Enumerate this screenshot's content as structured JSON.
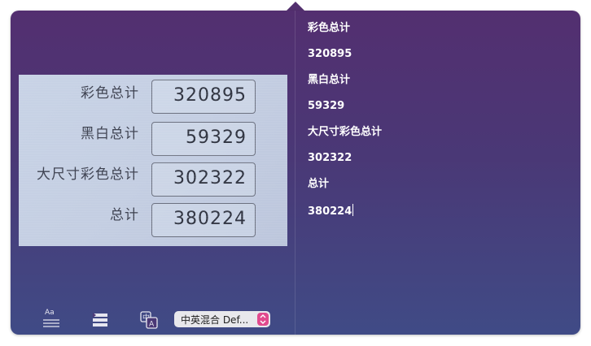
{
  "photo": {
    "rows": [
      {
        "label": "彩色总计",
        "value": "320895"
      },
      {
        "label": "黑白总计",
        "value": "59329"
      },
      {
        "label": "大尺寸彩色总计",
        "value": "302322"
      },
      {
        "label": "总计",
        "value": "380224"
      }
    ]
  },
  "toolbar": {
    "font_icon_text": "Aa",
    "language_select": "中英混合  Def...",
    "icons": [
      "text-format-icon",
      "list-view-icon",
      "translate-icon",
      "updown-arrows-icon"
    ]
  },
  "results": [
    "彩色总计",
    "320895",
    "黑白总计",
    "59329",
    "大尺寸彩色总计",
    "302322",
    "总计",
    "380224"
  ],
  "colors": {
    "panel_top": "#532f70",
    "panel_bottom": "#404b86",
    "accent": "#e14a8e"
  }
}
